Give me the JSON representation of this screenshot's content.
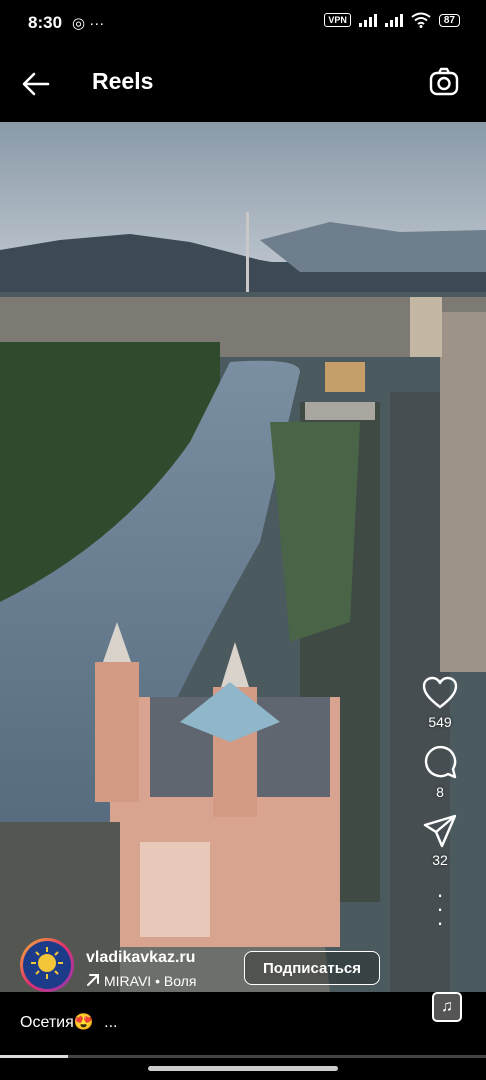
{
  "status": {
    "time": "8:30",
    "left_icons": "◎ ···",
    "vpn": "VPN",
    "battery": "87"
  },
  "header": {
    "title": "Reels"
  },
  "actions": {
    "likes": "549",
    "comments": "8",
    "shares": "32"
  },
  "author": {
    "username": "vladikavkaz.ru",
    "music": "MIRAVI • Воля",
    "subscribe_label": "Подписаться"
  },
  "caption": {
    "text": "Осетия😍",
    "more": "..."
  },
  "playback": {
    "progress": 0.14
  },
  "colors": {
    "background": "#000000",
    "text": "#ffffff"
  }
}
